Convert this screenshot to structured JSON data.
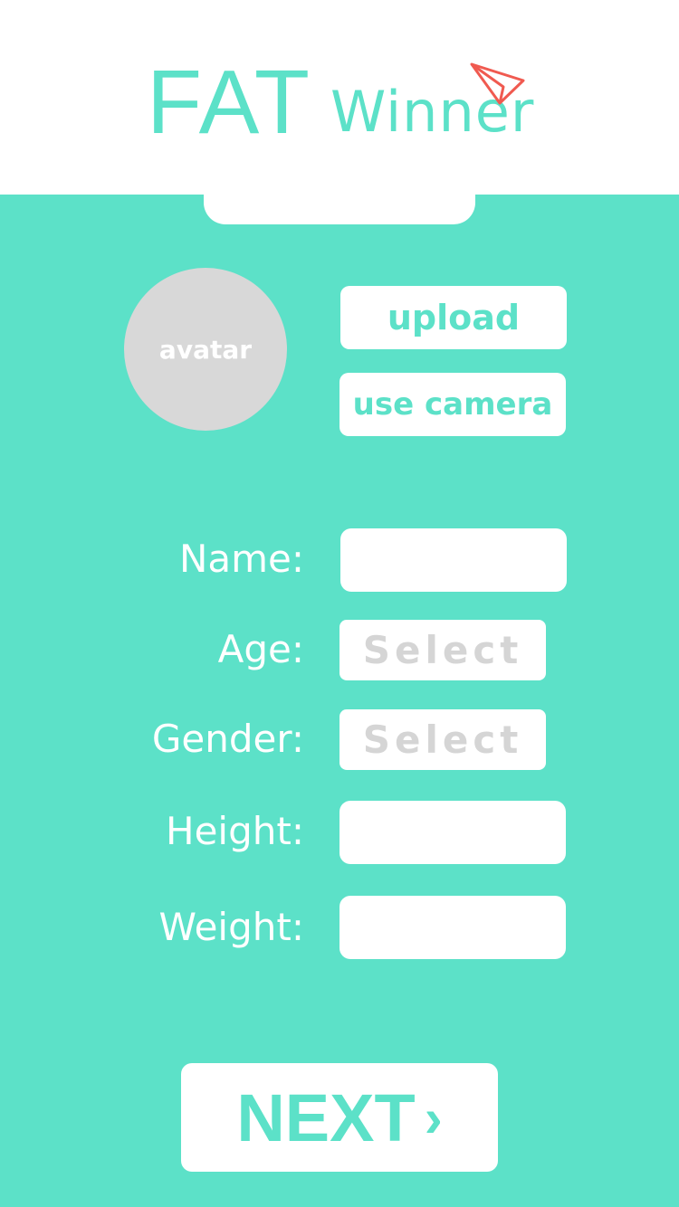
{
  "header": {
    "logo_fat": "FAT",
    "logo_winner": "Winner",
    "logo_icon": "paper-plane-icon"
  },
  "profile": {
    "avatar_label": "avatar",
    "upload_label": "upload",
    "camera_label": "use camera"
  },
  "form": {
    "name_label": "Name:",
    "name_value": "",
    "age_label": "Age:",
    "age_select": "Select",
    "gender_label": "Gender:",
    "gender_select": "Select",
    "height_label": "Height:",
    "height_value": "",
    "weight_label": "Weight:",
    "weight_value": ""
  },
  "footer": {
    "next_label": "NEXT",
    "next_icon": "chevron-right-icon",
    "next_glyph": "›"
  },
  "colors": {
    "accent": "#5ce1c8",
    "plane": "#f05a50",
    "avatar_bg": "#d8d8d8",
    "placeholder": "#d5d5d5"
  }
}
